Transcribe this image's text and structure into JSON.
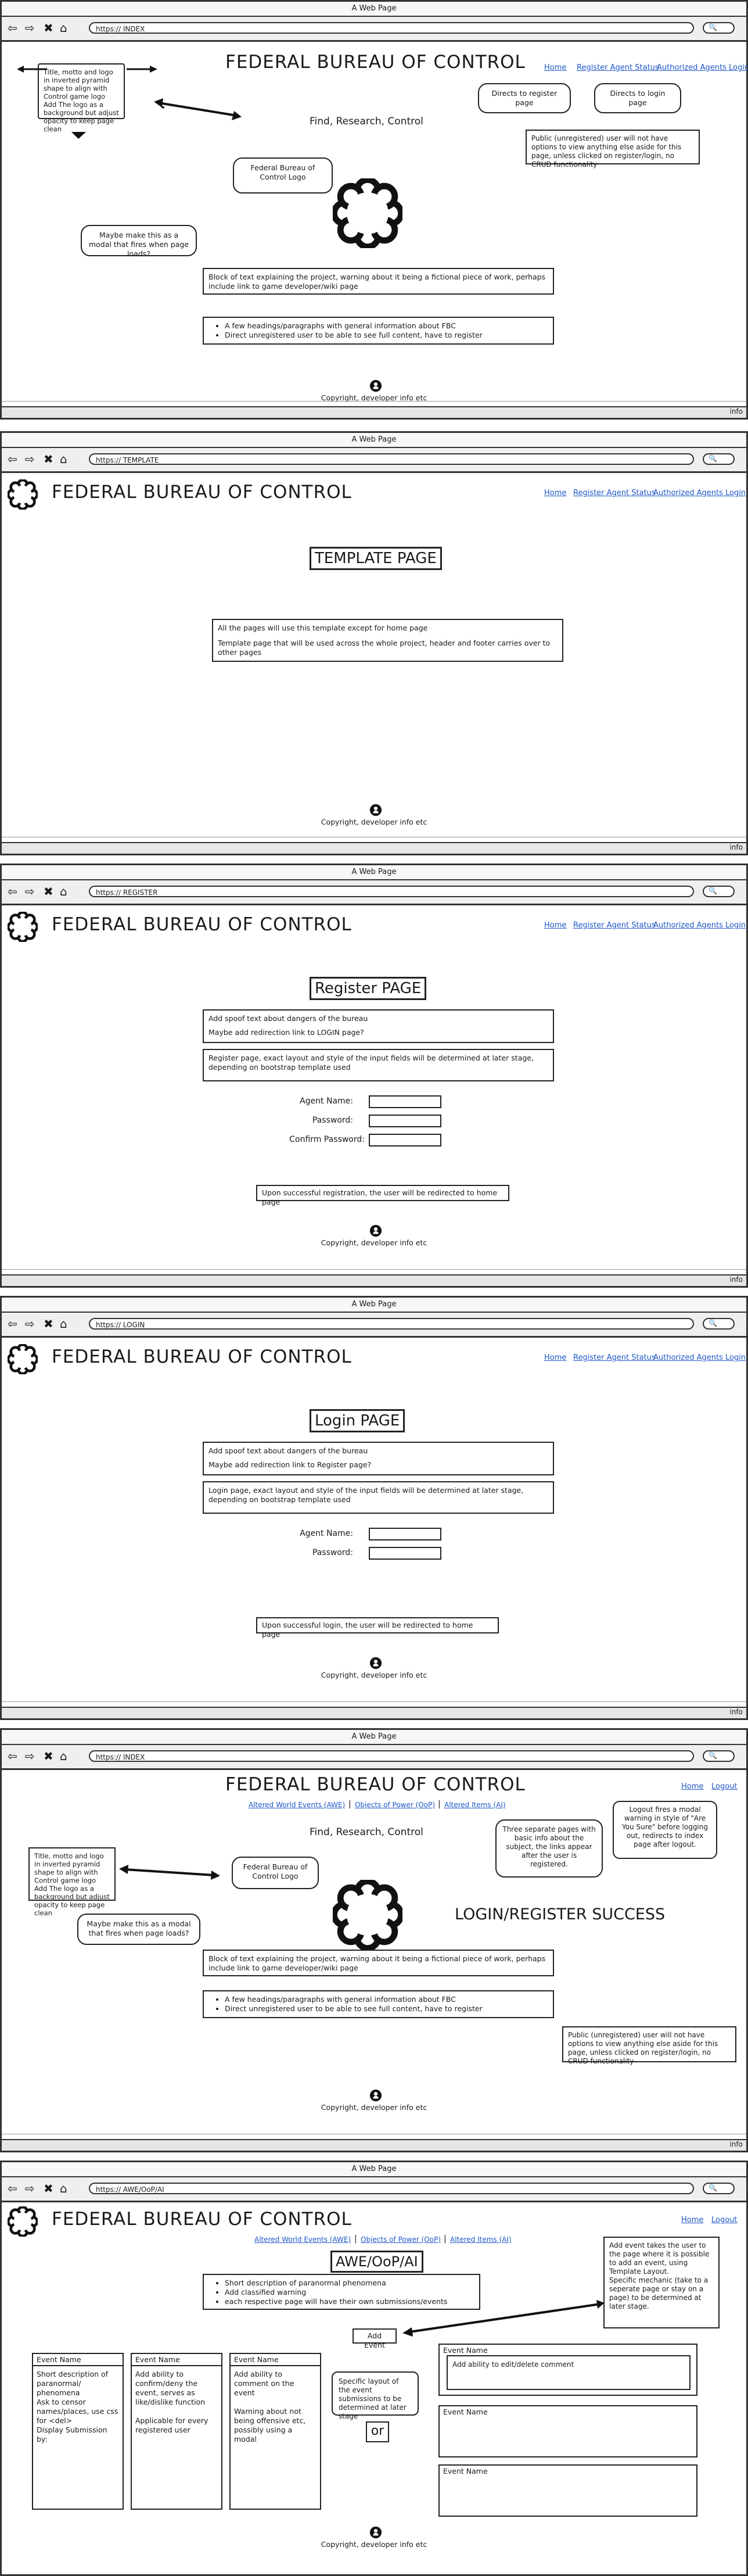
{
  "common": {
    "window_title": "A Web Page",
    "site_title": "FEDERAL BUREAU OF CONTROL",
    "footer": "Copyright, developer info etc",
    "info_label": "info",
    "nav": {
      "home": "Home",
      "register": "Register Agent Status",
      "login": "Authorized Agents Login",
      "logout": "Logout"
    }
  },
  "index": {
    "url": "https://  INDEX",
    "tagline": "Find, Research, Control",
    "logo_note": "Title, motto and logo in inverted pyramid shape to align with Control game logo\nAdd The logo as a background but adjust opacity to keep page clean",
    "register_bubble": "Directs to register page",
    "login_bubble": "Directs to login page",
    "public_note": "Public (unregistered) user will not have options to view anything else aside for this page, unless clicked on register/login, no CRUD functionality",
    "logo_bubble": "Federal Bureau of Control Logo",
    "modal_bubble": "Maybe make this as a modal that fires when page loads?",
    "intro_text": "Block of text explaining the project, warning about it being a fictional piece of work, perhaps include link to game developer/wiki page",
    "bullets": [
      "A few headings/paragraphs with general information about FBC",
      "Direct unregistered user to be able to see full content, have to register"
    ]
  },
  "template": {
    "url": "https://  TEMPLATE",
    "page_title": "TEMPLATE PAGE",
    "note_1": "All the pages will use this template except for home page",
    "note_2": "Template page that will be used across the whole project, header and footer carries over to other pages"
  },
  "register": {
    "url": "https://  REGISTER",
    "page_title": "Register PAGE",
    "text_1": "Add spoof text about dangers of the bureau",
    "text_2": "Maybe add redirection link to LOGIN page?",
    "layout_note": "Register page, exact layout and style of the input fields will be determined at later stage, depending on bootstrap template used",
    "labels": [
      "Agent Name:",
      "Password:",
      "Confirm Password:"
    ],
    "success_note": "Upon successful registration, the user will be redirected to home page"
  },
  "login": {
    "url": "https://  LOGIN",
    "page_title": "Login PAGE",
    "text_1": "Add spoof text about dangers of the bureau",
    "text_2": "Maybe add redirection link to Register page?",
    "layout_note": "Login page, exact layout and style of the input fields will be determined at later stage, depending on bootstrap template used",
    "labels": [
      "Agent Name:",
      "Password:"
    ],
    "success_note": "Upon successful login, the user will be redirected to home page"
  },
  "success": {
    "url": "https://  INDEX",
    "subnav": [
      "Altered World Events (AWE)",
      "Objects of Power (OoP)",
      "Altered Items (AI)"
    ],
    "three_pages_note": "Three separate pages with basic info about the subject, the links appear after the user is registered.",
    "logout_note": "Logout fires a modal warning in style of \"Are You Sure\" before logging out, redirects to index page after logout.",
    "status_text": "LOGIN/REGISTER SUCCESS",
    "logo_note": "Title, motto and logo in inverted pyramid shape to align with Control game logo\nAdd The logo as a background but adjust opacity to keep page clean"
  },
  "awe": {
    "url": "https://  AWE/OoP/AI",
    "page_title": "AWE/OoP/AI",
    "bullets": [
      "Short description of paranormal phenomena",
      "Add classified warning",
      "each respective page will have their own submissions/events"
    ],
    "add_event_note": "Add event takes the user to the page where it is possible to add an event, using Template Layout.\nSpecific mechanic (take to a seperate page or stay on a page) to be determined at later stage.",
    "add_event_button": "Add Event",
    "event_name": "Event Name",
    "col_1": "Short description of paranormal/ phenomena\nAsk to censor names/places, use css for <del>\nDisplay Submission by:",
    "col_2": "Add ability to confirm/deny the event, serves as like/dislike function\n\nApplicable for every registered user",
    "col_3": "Add ability to comment on the event\n\nWarning about not being offensive etc, possibly using a modal",
    "layout_note": "Specific layout of the event submissions to be determined at later stage",
    "or_label": "or",
    "edit_note": "Add ability to edit/delete comment"
  }
}
